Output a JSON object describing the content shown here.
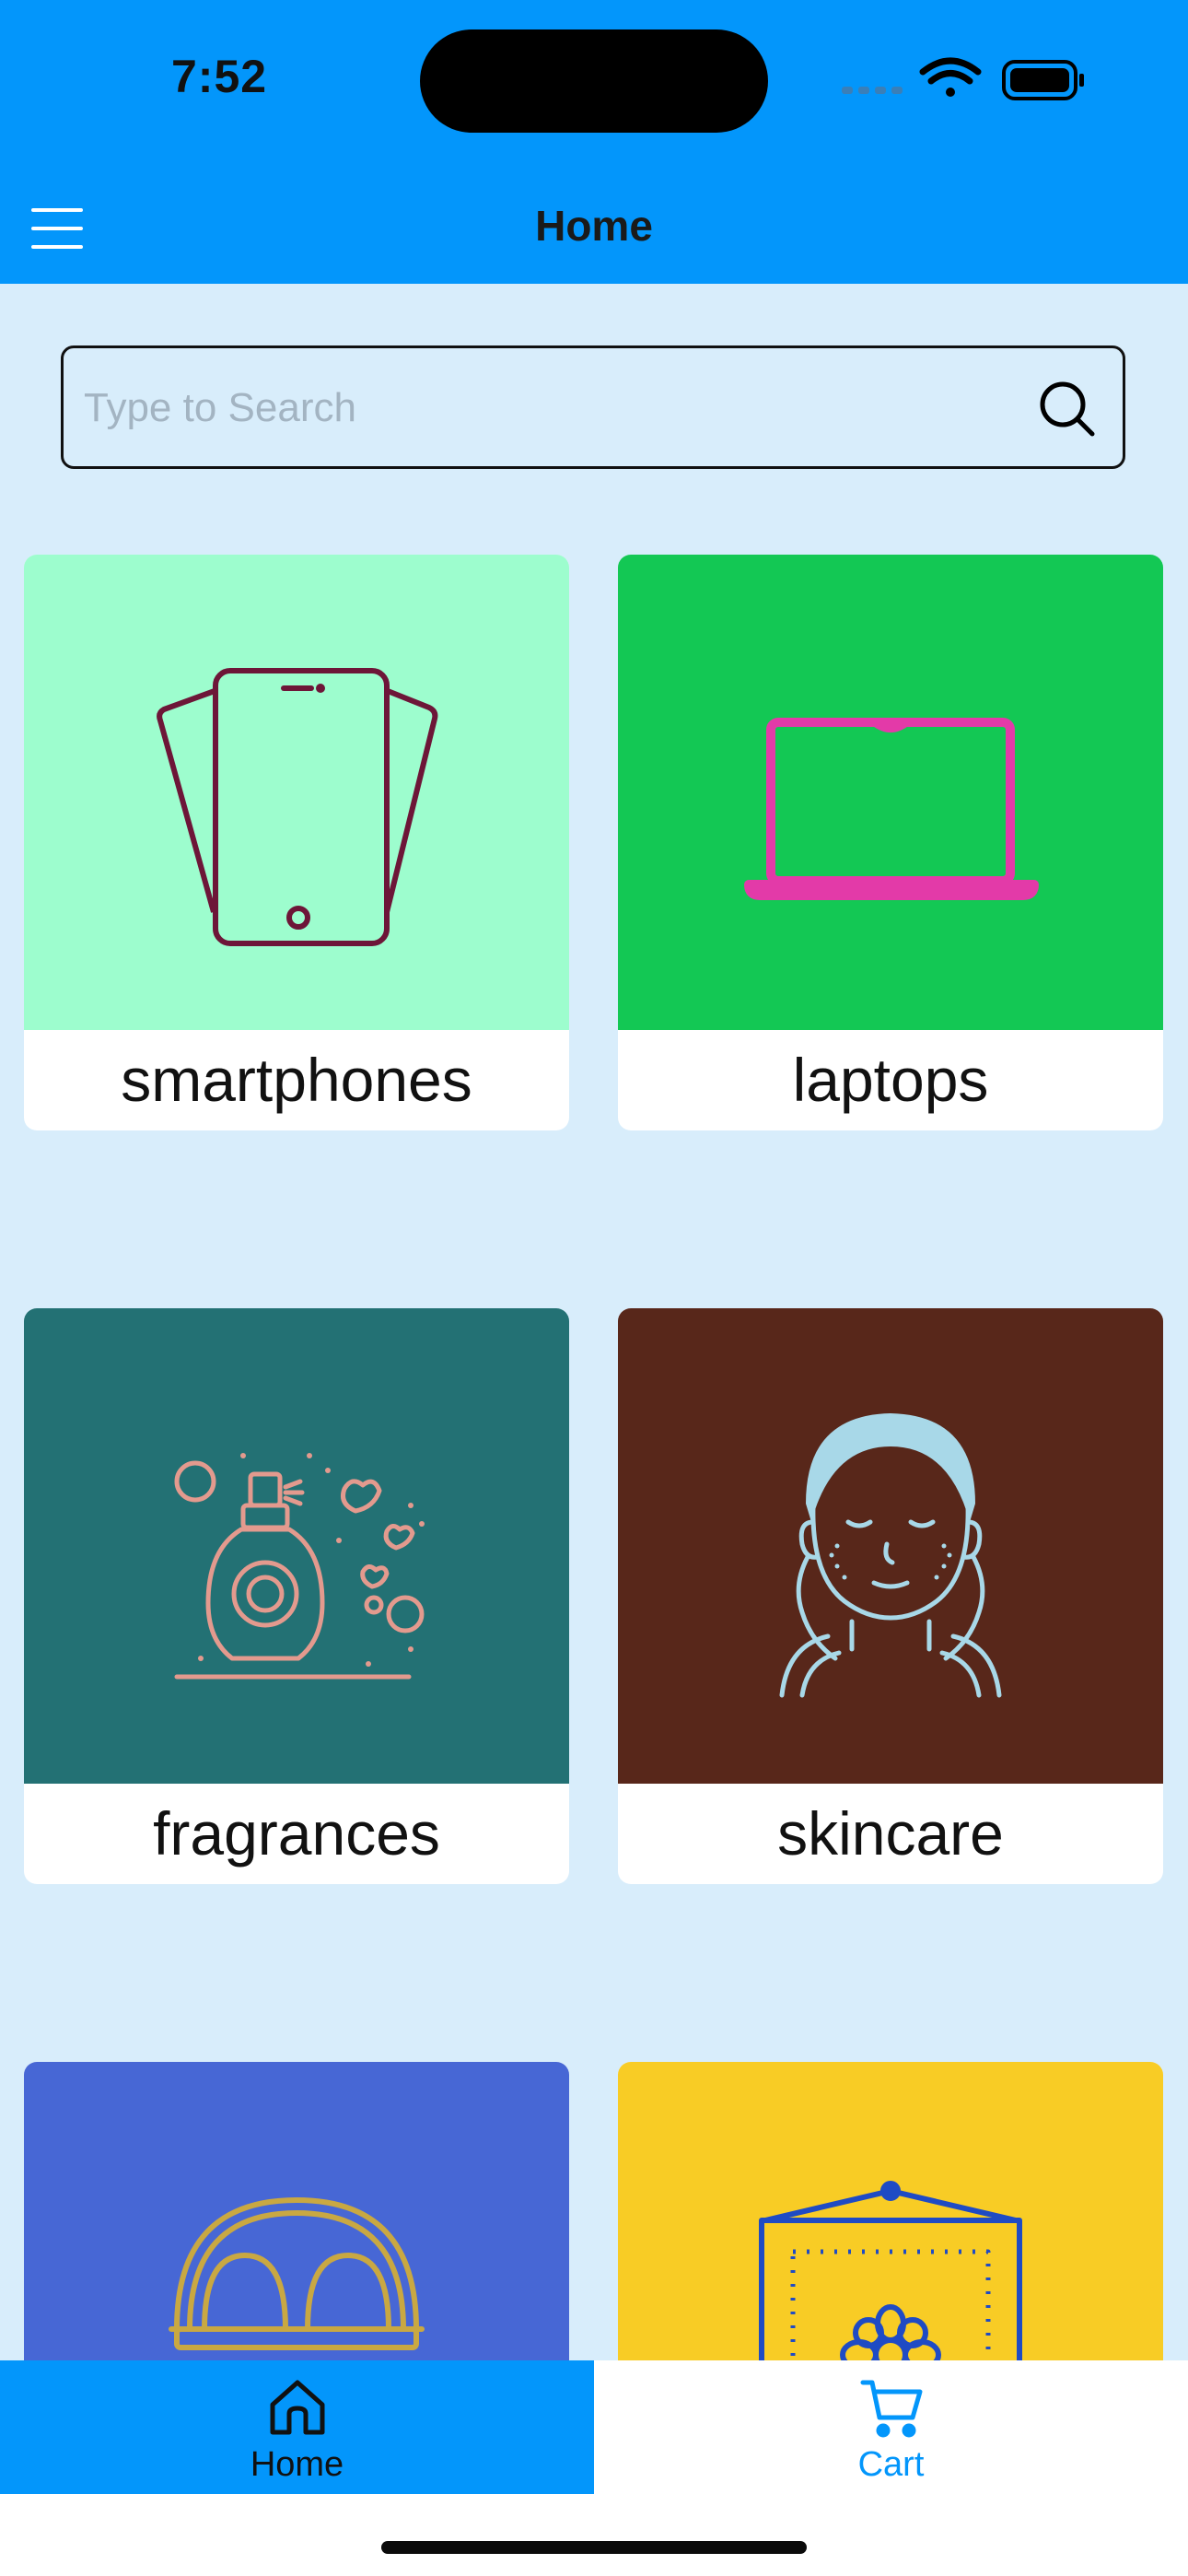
{
  "status": {
    "time": "7:52"
  },
  "nav": {
    "title": "Home"
  },
  "search": {
    "placeholder": "Type to Search",
    "value": ""
  },
  "categories": [
    {
      "label": "smartphones",
      "bg": "#9dfdce",
      "icon": "smartphone-icon"
    },
    {
      "label": "laptops",
      "bg": "#13c854",
      "icon": "laptop-icon"
    },
    {
      "label": "fragrances",
      "bg": "#237174",
      "icon": "perfume-bottle-icon"
    },
    {
      "label": "skincare",
      "bg": "#58271a",
      "icon": "face-care-icon"
    },
    {
      "label": "",
      "bg": "#4767d5",
      "icon": "eggs-basket-icon"
    },
    {
      "label": "",
      "bg": "#f8cc25",
      "icon": "flower-frame-icon"
    }
  ],
  "tabs": [
    {
      "label": "Home",
      "icon": "home-icon",
      "active": true
    },
    {
      "label": "Cart",
      "icon": "cart-icon",
      "active": false
    }
  ],
  "colors": {
    "accent": "#0396fb",
    "background": "#d8edfb",
    "cart_tab_text": "#0396fb"
  }
}
